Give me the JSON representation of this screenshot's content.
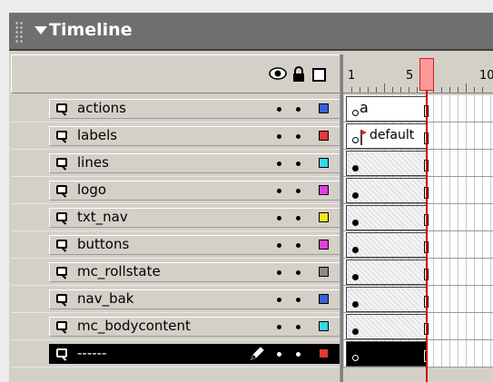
{
  "panel": {
    "title": "Timeline"
  },
  "ruler": {
    "labels": [
      "1",
      "5",
      "10"
    ]
  },
  "layers": [
    {
      "name": "actions",
      "outline_color": "#3a5fd9",
      "frame": {
        "type": "action",
        "action_glyph": "a"
      }
    },
    {
      "name": "labels",
      "outline_color": "#e03a3a",
      "frame": {
        "type": "label",
        "label_text": "default"
      }
    },
    {
      "name": "lines",
      "outline_color": "#33d9e6",
      "frame": {
        "type": "tween"
      }
    },
    {
      "name": "logo",
      "outline_color": "#e23ee2",
      "frame": {
        "type": "tween"
      }
    },
    {
      "name": "txt_nav",
      "outline_color": "#f2e61c",
      "frame": {
        "type": "tween"
      }
    },
    {
      "name": "buttons",
      "outline_color": "#dd44d8",
      "frame": {
        "type": "tween"
      }
    },
    {
      "name": "mc_rollstate",
      "outline_color": "#8a8a8a",
      "frame": {
        "type": "tween"
      }
    },
    {
      "name": "nav_bak",
      "outline_color": "#3a5fd9",
      "frame": {
        "type": "tween"
      }
    },
    {
      "name": "mc_bodycontent",
      "outline_color": "#33d9e6",
      "frame": {
        "type": "tween"
      }
    },
    {
      "name": "------",
      "outline_color": "#e03a3a",
      "selected": true,
      "frame": {
        "type": "selected"
      }
    }
  ],
  "icons": {
    "visibility": "eye-icon",
    "lock": "lock-icon",
    "outline": "outline-icon",
    "layer": "layer-icon",
    "edit": "pencil-icon"
  },
  "colors": {
    "titlebar": "#6f6f6f",
    "playhead": "#ff9999",
    "selected_row": "#000000"
  }
}
